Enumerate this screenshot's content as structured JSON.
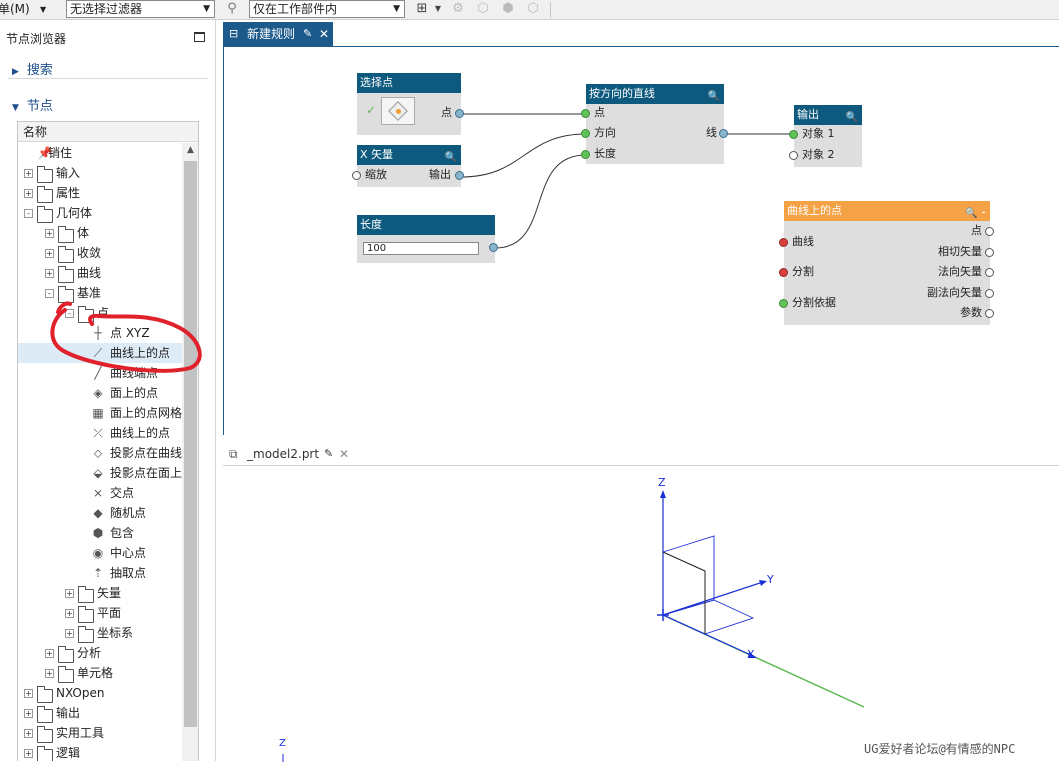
{
  "toolbar": {
    "menu_label": "菜单(M)",
    "filter_value": "无选择过滤器",
    "scope_value": "仅在工作部件内"
  },
  "left_panel": {
    "title": "节点浏览器",
    "search_label": "搜索",
    "nodes_label": "节点",
    "column_header": "名称",
    "tree": [
      {
        "label": "销住",
        "level": 1,
        "expander": "none",
        "icon": "pin-icon"
      },
      {
        "label": "输入",
        "level": 1,
        "expander": "+",
        "icon": "folder-icon"
      },
      {
        "label": "属性",
        "level": 1,
        "expander": "+",
        "icon": "folder-icon"
      },
      {
        "label": "几何体",
        "level": 1,
        "expander": "-",
        "icon": "folder-icon"
      },
      {
        "label": "体",
        "level": 2,
        "expander": "+",
        "icon": "folder-icon"
      },
      {
        "label": "收敛",
        "level": 2,
        "expander": "+",
        "icon": "folder-icon"
      },
      {
        "label": "曲线",
        "level": 2,
        "expander": "+",
        "icon": "folder-icon"
      },
      {
        "label": "基准",
        "level": 2,
        "expander": "-",
        "icon": "folder-icon"
      },
      {
        "label": "点",
        "level": 3,
        "expander": "-",
        "icon": "folder-icon"
      },
      {
        "label": "点 XYZ",
        "level": 4,
        "expander": "none",
        "icon": "point-xyz-icon"
      },
      {
        "label": "曲线上的点",
        "level": 4,
        "expander": "none",
        "icon": "point-on-curve-icon",
        "selected": true
      },
      {
        "label": "曲线端点",
        "level": 4,
        "expander": "none",
        "icon": "curve-endpoint-icon"
      },
      {
        "label": "面上的点",
        "level": 4,
        "expander": "none",
        "icon": "point-on-face-icon"
      },
      {
        "label": "面上的点网格",
        "level": 4,
        "expander": "none",
        "icon": "face-grid-icon"
      },
      {
        "label": "曲线上的点",
        "level": 4,
        "expander": "none",
        "icon": "curve-point-icon"
      },
      {
        "label": "投影点在曲线",
        "level": 4,
        "expander": "none",
        "icon": "project-curve-icon"
      },
      {
        "label": "投影点在面上",
        "level": 4,
        "expander": "none",
        "icon": "project-face-icon"
      },
      {
        "label": "交点",
        "level": 4,
        "expander": "none",
        "icon": "intersection-icon"
      },
      {
        "label": "随机点",
        "level": 4,
        "expander": "none",
        "icon": "random-point-icon"
      },
      {
        "label": "包含",
        "level": 4,
        "expander": "none",
        "icon": "contain-icon"
      },
      {
        "label": "中心点",
        "level": 4,
        "expander": "none",
        "icon": "center-point-icon"
      },
      {
        "label": "抽取点",
        "level": 4,
        "expander": "none",
        "icon": "extract-point-icon"
      },
      {
        "label": "矢量",
        "level": 3,
        "expander": "+",
        "icon": "folder-icon"
      },
      {
        "label": "平面",
        "level": 3,
        "expander": "+",
        "icon": "folder-icon"
      },
      {
        "label": "坐标系",
        "level": 3,
        "expander": "+",
        "icon": "folder-icon"
      },
      {
        "label": "分析",
        "level": 2,
        "expander": "+",
        "icon": "folder-icon"
      },
      {
        "label": "单元格",
        "level": 2,
        "expander": "+",
        "icon": "folder-icon"
      },
      {
        "label": "NXOpen",
        "level": 1,
        "expander": "+",
        "icon": "folder-icon"
      },
      {
        "label": "输出",
        "level": 1,
        "expander": "+",
        "icon": "folder-icon"
      },
      {
        "label": "实用工具",
        "level": 1,
        "expander": "+",
        "icon": "folder-icon"
      },
      {
        "label": "逻辑",
        "level": 1,
        "expander": "+",
        "icon": "folder-icon"
      }
    ]
  },
  "graph": {
    "tab_label": "新建规则",
    "nodes": {
      "select_point": {
        "title": "选择点",
        "out_label": "点"
      },
      "x_vector": {
        "title": "X 矢量",
        "in_label": "缩放",
        "out_label": "输出"
      },
      "length": {
        "title": "长度",
        "value": "100"
      },
      "line_by_dir": {
        "title": "按方向的直线",
        "in1": "点",
        "in2": "方向",
        "in3": "长度",
        "out_label": "线"
      },
      "output": {
        "title": "输出",
        "in1": "对象 1",
        "in2": "对象 2"
      },
      "point_on_curve": {
        "title": "曲线上的点",
        "in1": "曲线",
        "in2": "分割",
        "in3": "分割依据",
        "out1": "点",
        "out2": "相切矢量",
        "out3": "法向矢量",
        "out4": "副法向矢量",
        "out5": "参数"
      }
    }
  },
  "model": {
    "tab_label": "_model2.prt",
    "axis_z": "Z",
    "axis_y": "Y",
    "axis_x": "X",
    "axis_z2": "Z"
  },
  "watermark": "UG爱好者论坛@有情感的NPC",
  "colors": {
    "node_header": "#0e5a7e",
    "node_header_orange": "#f5a247",
    "port_green": "#62c25a",
    "port_red": "#d8403c",
    "annotation_red": "#e0202a",
    "axis_blue": "#1a2fd6",
    "line_green": "#5cba52"
  }
}
